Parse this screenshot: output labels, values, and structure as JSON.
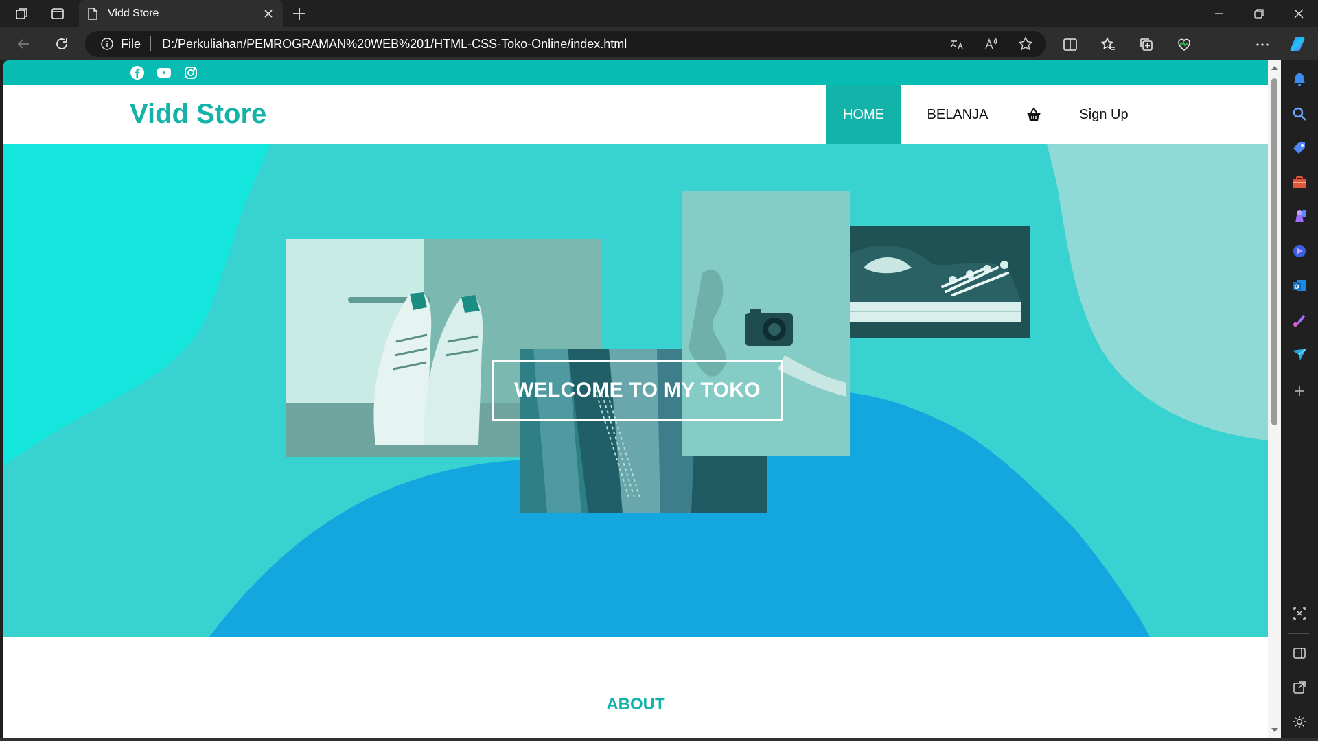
{
  "browser": {
    "tab_title": "Vidd Store",
    "url_scheme_label": "File",
    "url": "D:/Perkuliahan/PEMROGRAMAN%20WEB%201/HTML-CSS-Toko-Online/index.html"
  },
  "site": {
    "brand": "Vidd Store",
    "nav": {
      "home": "HOME",
      "shop": "BELANJA",
      "signup": "Sign Up"
    },
    "social_icons": [
      "facebook-icon",
      "youtube-icon",
      "instagram-icon"
    ],
    "hero": {
      "welcome": "WELCOME TO MY TOKO"
    },
    "about_title": "ABOUT"
  },
  "colors": {
    "accent": "#13b3a9",
    "topstrip": "#06bcb3",
    "hero_bg": "#38d3d0",
    "hero_blob_blue": "#14a6df"
  }
}
